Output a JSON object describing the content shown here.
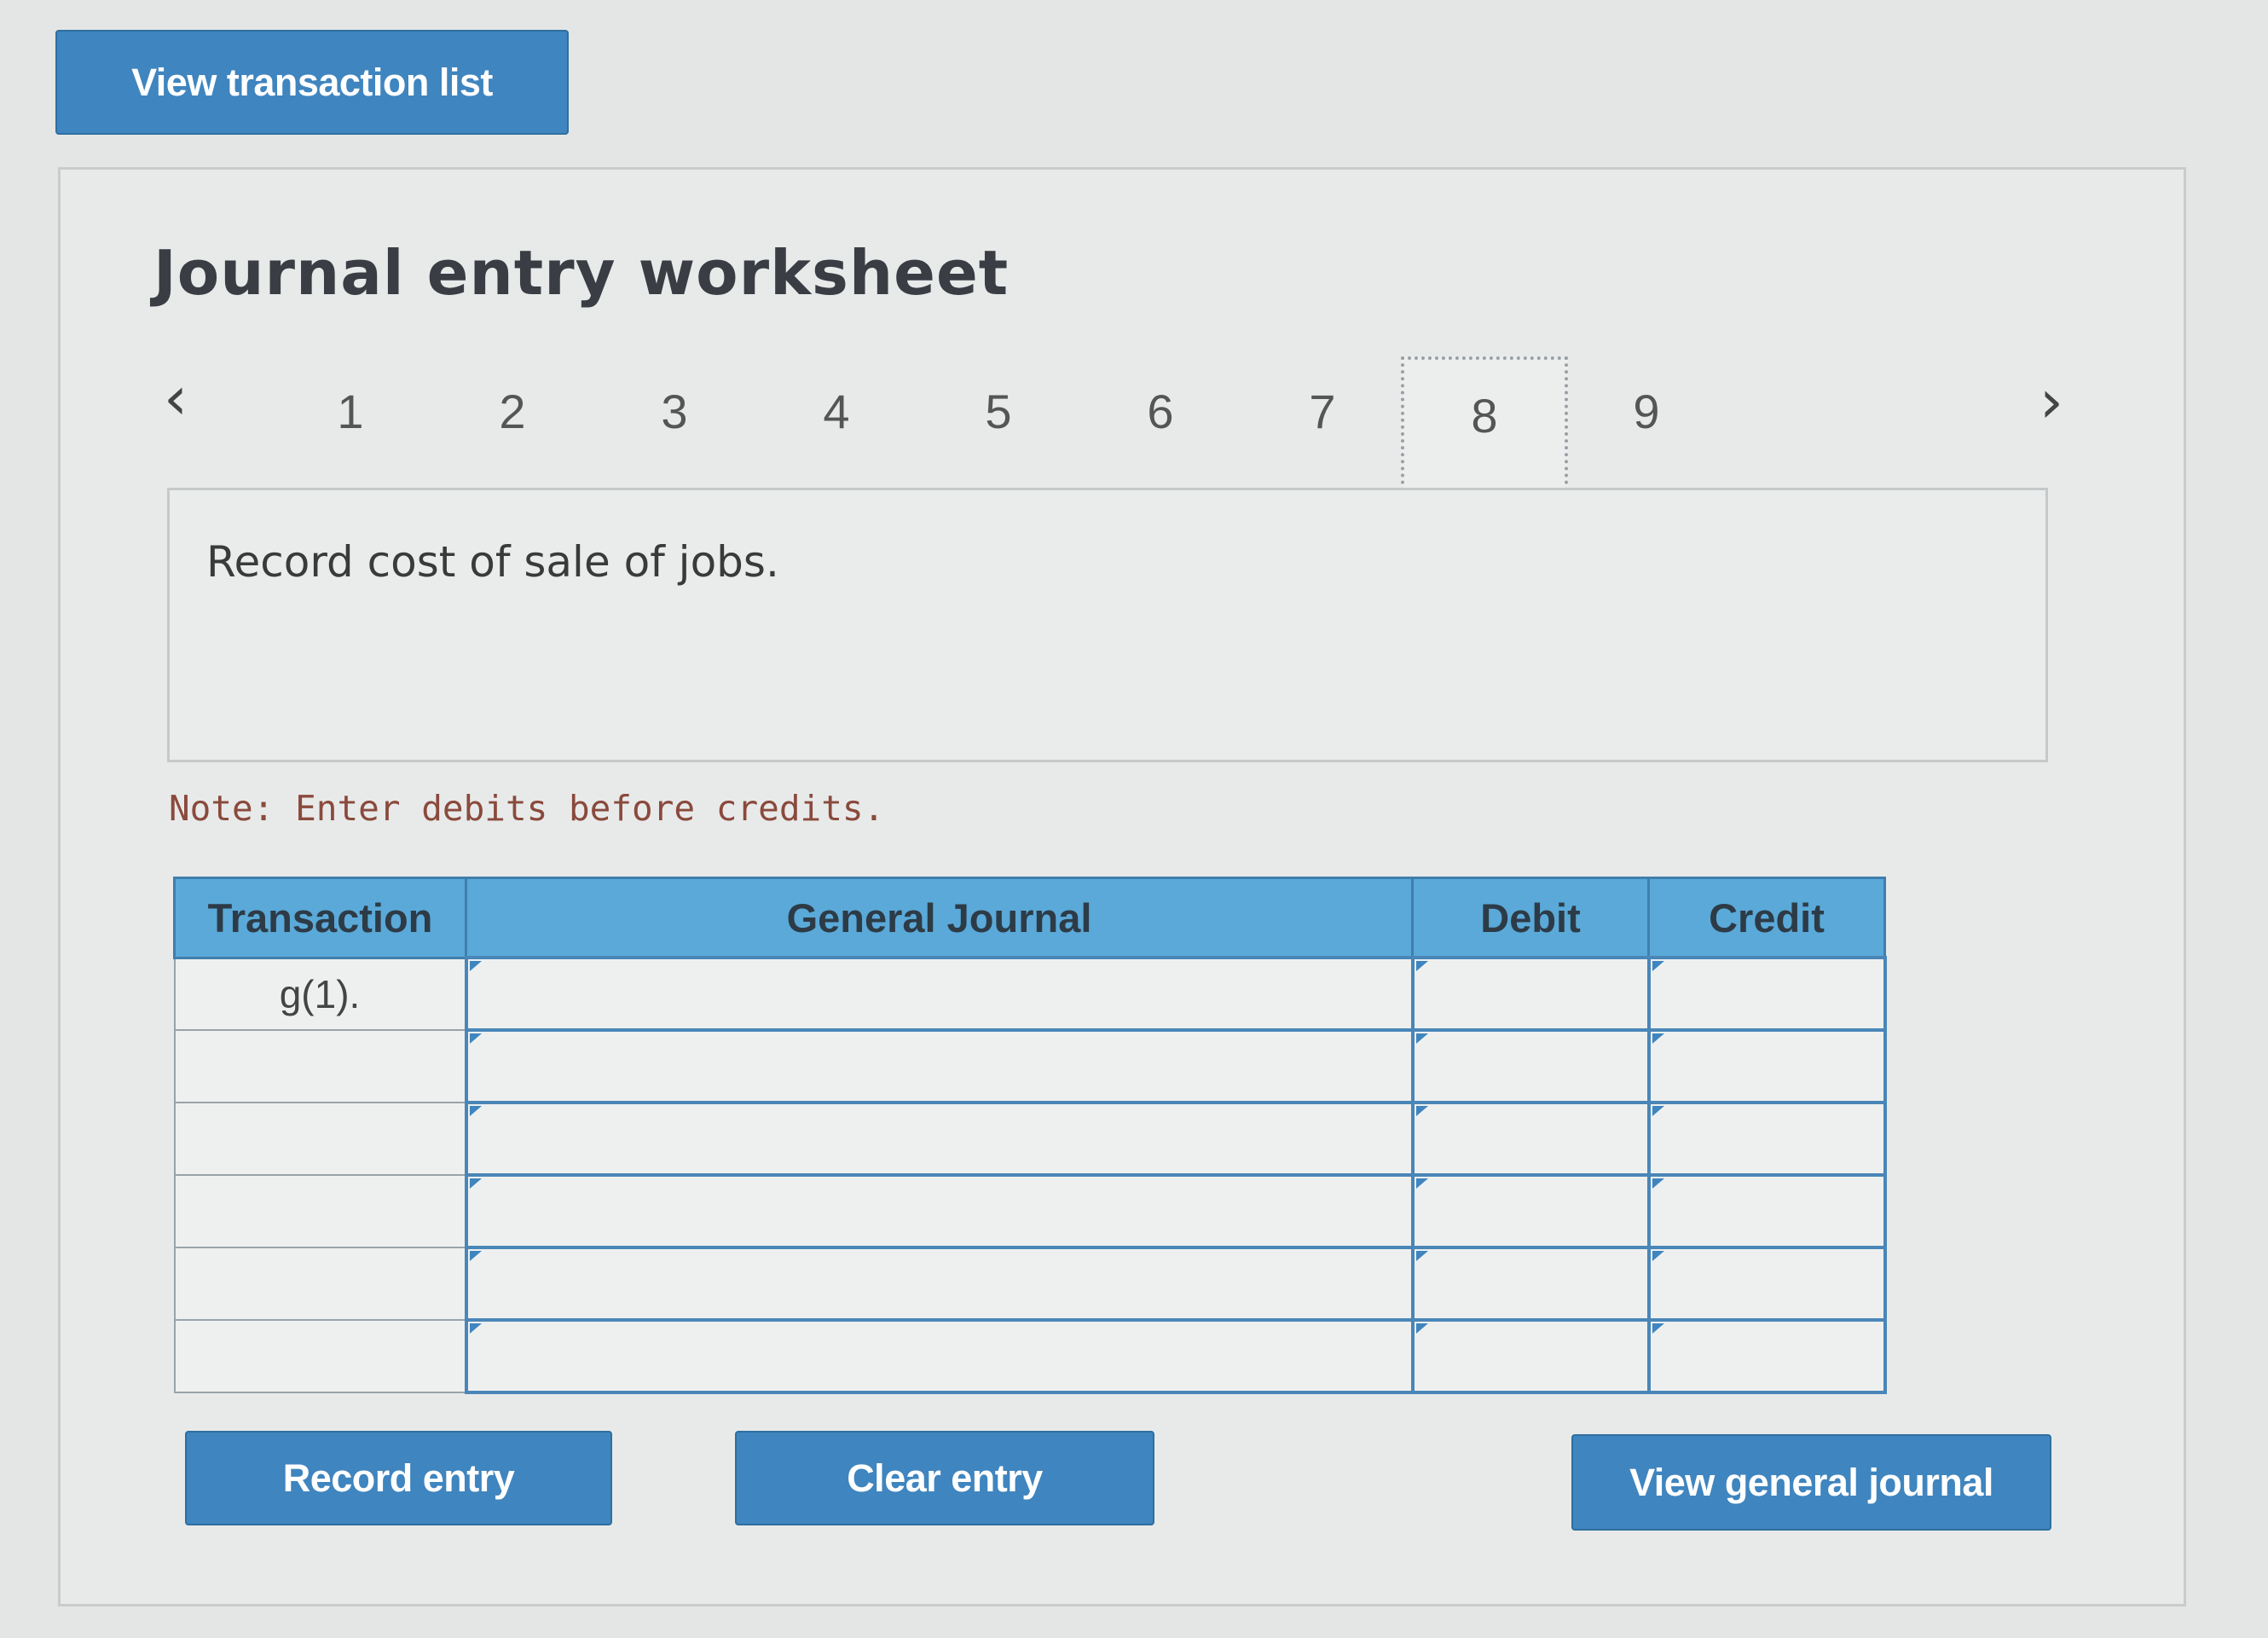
{
  "buttons": {
    "view_transaction_list": "View transaction list",
    "record_entry": "Record entry",
    "clear_entry": "Clear entry",
    "view_general_journal": "View general journal"
  },
  "worksheet": {
    "title": "Journal entry worksheet",
    "pagination": {
      "pages": [
        "1",
        "2",
        "3",
        "4",
        "5",
        "6",
        "7",
        "8",
        "9"
      ],
      "active": "8",
      "prev_icon": "chevron-left-icon",
      "next_icon": "chevron-right-icon"
    },
    "description": "Record cost of sale of jobs.",
    "note": "Note: Enter debits before credits."
  },
  "table": {
    "headers": [
      "Transaction",
      "General Journal",
      "Debit",
      "Credit"
    ],
    "rows": [
      {
        "transaction": "g(1).",
        "general_journal": "",
        "debit": "",
        "credit": ""
      },
      {
        "transaction": "",
        "general_journal": "",
        "debit": "",
        "credit": ""
      },
      {
        "transaction": "",
        "general_journal": "",
        "debit": "",
        "credit": ""
      },
      {
        "transaction": "",
        "general_journal": "",
        "debit": "",
        "credit": ""
      },
      {
        "transaction": "",
        "general_journal": "",
        "debit": "",
        "credit": ""
      },
      {
        "transaction": "",
        "general_journal": "",
        "debit": "",
        "credit": ""
      }
    ]
  },
  "colors": {
    "button_blue": "#3f85bf",
    "header_blue": "#5aa9d8",
    "note_red": "#8a4a3c"
  }
}
